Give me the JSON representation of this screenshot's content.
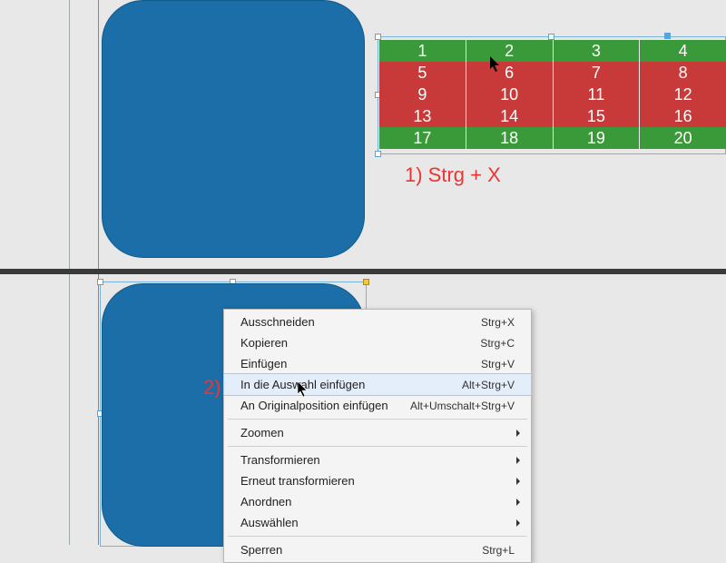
{
  "top": {
    "table": [
      [
        "1",
        "2",
        "3",
        "4"
      ],
      [
        "5",
        "6",
        "7",
        "8"
      ],
      [
        "9",
        "10",
        "11",
        "12"
      ],
      [
        "13",
        "14",
        "15",
        "16"
      ],
      [
        "17",
        "18",
        "19",
        "20"
      ]
    ],
    "row_colors": [
      "g",
      "r",
      "r",
      "r",
      "g"
    ],
    "annotation": "1) Strg + X"
  },
  "bottom": {
    "annotation": "2)"
  },
  "context_menu": {
    "items": [
      {
        "label": "Ausschneiden",
        "shortcut": "Strg+X"
      },
      {
        "label": "Kopieren",
        "shortcut": "Strg+C"
      },
      {
        "label": "Einfügen",
        "shortcut": "Strg+V"
      },
      {
        "label": "In die Auswahl einfügen",
        "shortcut": "Alt+Strg+V",
        "hover": true
      },
      {
        "label": "An Originalposition einfügen",
        "shortcut": "Alt+Umschalt+Strg+V"
      },
      {
        "sep": true
      },
      {
        "label": "Zoomen",
        "sub": true
      },
      {
        "sep": true
      },
      {
        "label": "Transformieren",
        "sub": true
      },
      {
        "label": "Erneut transformieren",
        "sub": true
      },
      {
        "label": "Anordnen",
        "sub": true
      },
      {
        "label": "Auswählen",
        "sub": true
      },
      {
        "sep": true
      },
      {
        "label": "Sperren",
        "shortcut": "Strg+L"
      }
    ]
  }
}
